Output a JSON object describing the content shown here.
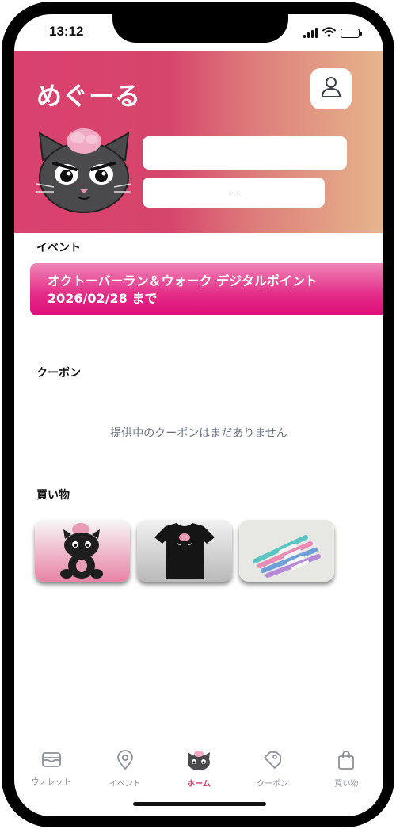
{
  "status_bar": {
    "time": "13:12"
  },
  "header": {
    "app_title": "めぐーる",
    "profile_value": "",
    "point_value": "-"
  },
  "events": {
    "section_title": "イベント",
    "cards": [
      {
        "name": "オクトーバーラン＆ウォーク デジタルポイント",
        "date_text": "2026/02/28 まで"
      }
    ]
  },
  "coupons": {
    "section_title": "クーポン",
    "empty_message": "提供中のクーポンはまだありません"
  },
  "shopping": {
    "section_title": "買い物",
    "items": [
      {
        "image_icon": "plush-cat-icon"
      },
      {
        "image_icon": "tshirt-icon"
      },
      {
        "image_icon": "pens-icon"
      }
    ]
  },
  "tabbar": {
    "tabs": [
      {
        "label": "ウォレット",
        "icon": "wallet-icon"
      },
      {
        "label": "イベント",
        "icon": "location-pin-icon"
      },
      {
        "label": "ホーム",
        "icon": "cat-mascot-icon",
        "active": true
      },
      {
        "label": "クーポン",
        "icon": "tag-icon"
      },
      {
        "label": "買い物",
        "icon": "shopping-bag-icon"
      }
    ]
  },
  "colors": {
    "brand_pink": "#d9416e",
    "active_tab": "#d6336c",
    "event_card": "#e32c87"
  }
}
